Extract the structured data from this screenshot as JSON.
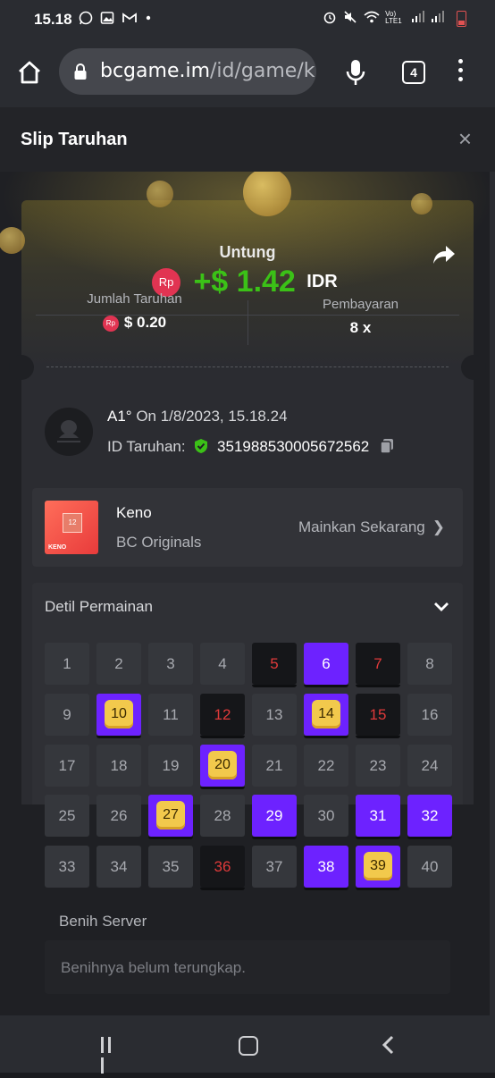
{
  "status_bar": {
    "time": "15.18",
    "left_icons": [
      "whatsapp-icon",
      "image-icon",
      "gmail-icon",
      "dot-icon"
    ],
    "right_text": "Vo) LTE1"
  },
  "browser": {
    "url_host": "bcgame.im",
    "url_path": "/id/game/k…",
    "tab_count": "4"
  },
  "header": {
    "title": "Slip Taruhan",
    "close_label": "×"
  },
  "summary": {
    "profit_label": "Untung",
    "currency_badge": "Rp",
    "profit_amount": "+$ 1.42",
    "profit_currency": "IDR",
    "bet_amount_label": "Jumlah Taruhan",
    "bet_amount_value": "$ 0.20",
    "payout_label": "Pembayaran",
    "payout_value": "8 x"
  },
  "bet": {
    "user": "A1°",
    "date_text": "On 1/8/2023, 15.18.24",
    "bet_id_label": "ID Taruhan:",
    "bet_id_value": "351988530005672562"
  },
  "game": {
    "thumb_number": "12",
    "thumb_label": "KENO",
    "name": "Keno",
    "provider": "BC Originals",
    "play_label": "Mainkan Sekarang"
  },
  "details": {
    "title": "Detil Permainan",
    "cells": [
      {
        "n": "1",
        "s": "normal"
      },
      {
        "n": "2",
        "s": "normal"
      },
      {
        "n": "3",
        "s": "normal"
      },
      {
        "n": "4",
        "s": "normal"
      },
      {
        "n": "5",
        "s": "red"
      },
      {
        "n": "6",
        "s": "sel"
      },
      {
        "n": "7",
        "s": "red"
      },
      {
        "n": "8",
        "s": "normal"
      },
      {
        "n": "9",
        "s": "normal"
      },
      {
        "n": "10",
        "s": "hit"
      },
      {
        "n": "11",
        "s": "normal"
      },
      {
        "n": "12",
        "s": "red"
      },
      {
        "n": "13",
        "s": "normal"
      },
      {
        "n": "14",
        "s": "hit"
      },
      {
        "n": "15",
        "s": "red"
      },
      {
        "n": "16",
        "s": "normal"
      },
      {
        "n": "17",
        "s": "normal"
      },
      {
        "n": "18",
        "s": "normal"
      },
      {
        "n": "19",
        "s": "normal"
      },
      {
        "n": "20",
        "s": "hit"
      },
      {
        "n": "21",
        "s": "normal"
      },
      {
        "n": "22",
        "s": "normal"
      },
      {
        "n": "23",
        "s": "normal"
      },
      {
        "n": "24",
        "s": "normal"
      },
      {
        "n": "25",
        "s": "normal"
      },
      {
        "n": "26",
        "s": "normal"
      },
      {
        "n": "27",
        "s": "hit"
      },
      {
        "n": "28",
        "s": "normal"
      },
      {
        "n": "29",
        "s": "sel"
      },
      {
        "n": "30",
        "s": "normal"
      },
      {
        "n": "31",
        "s": "sel"
      },
      {
        "n": "32",
        "s": "sel"
      },
      {
        "n": "33",
        "s": "normal"
      },
      {
        "n": "34",
        "s": "normal"
      },
      {
        "n": "35",
        "s": "normal"
      },
      {
        "n": "36",
        "s": "red"
      },
      {
        "n": "37",
        "s": "normal"
      },
      {
        "n": "38",
        "s": "sel"
      },
      {
        "n": "39",
        "s": "hit"
      },
      {
        "n": "40",
        "s": "normal"
      }
    ],
    "seed_label": "Benih Server",
    "seed_placeholder": "Benihnya belum terungkap."
  },
  "colors": {
    "accent_green": "#3bc117",
    "selected_purple": "#6d22ff",
    "miss_red": "#e03a3a",
    "hit_gold": "#f2c94c",
    "rp_badge": "#e13452"
  }
}
